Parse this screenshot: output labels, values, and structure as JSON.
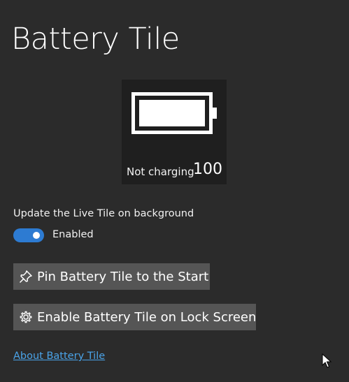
{
  "page": {
    "title": "Battery Tile"
  },
  "tile": {
    "status": "Not charging",
    "level": "100",
    "fill_fraction": 1.0,
    "icon": "battery-icon"
  },
  "live_tile_setting": {
    "label": "Update the Live Tile on background",
    "state_label": "Enabled",
    "on": true
  },
  "buttons": {
    "pin": {
      "label": "Pin Battery Tile to the Start",
      "icon": "pin-icon"
    },
    "lock": {
      "label": "Enable Battery Tile on Lock Screen",
      "icon": "gear-icon"
    }
  },
  "about_link": "About Battery Tile",
  "colors": {
    "background": "#2b2b2b",
    "tile_background": "#1f1f1f",
    "accent": "#2d7bd2",
    "button": "#555555",
    "link": "#4aa3e8"
  }
}
